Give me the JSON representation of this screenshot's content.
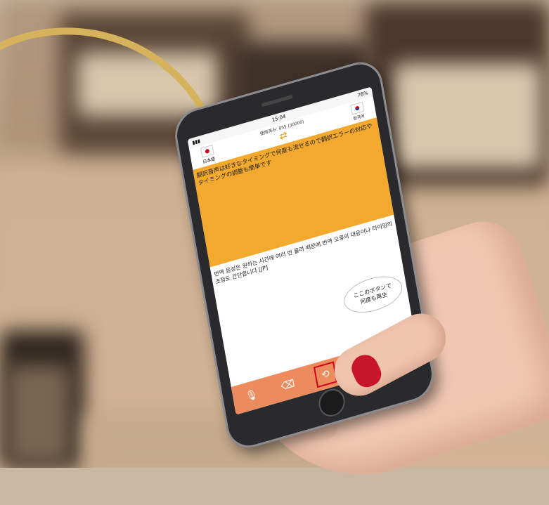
{
  "status_bar": {
    "time": "15:04",
    "battery": "76%"
  },
  "app": {
    "usage_label": "使用済み: 855 (30000)",
    "source_language": "日本語",
    "target_language": "한국어",
    "source_text": "翻訳音声は好きなタイミングで何度も流せるので翻訳エラーの対応やタイミングの調整も簡単です",
    "translated_text": "번역 음성은 원하는 시간에 여러 번 흘려 때문에 번역 오류의 대응이나 타이밍의 조정도 간단합니다 [JP]",
    "callout": {
      "line1": "ここのボタンで",
      "line2": "何度も再生"
    },
    "toolbar": {
      "icons": [
        "mic-icon",
        "eraser-icon",
        "replay-icon",
        "hand-icon",
        "mic-icon"
      ]
    }
  },
  "colors": {
    "source_panel": "#f2a92d",
    "toolbar": "#ec8c5e",
    "highlight_box": "#d0021b",
    "arc": "#d6b25c"
  }
}
